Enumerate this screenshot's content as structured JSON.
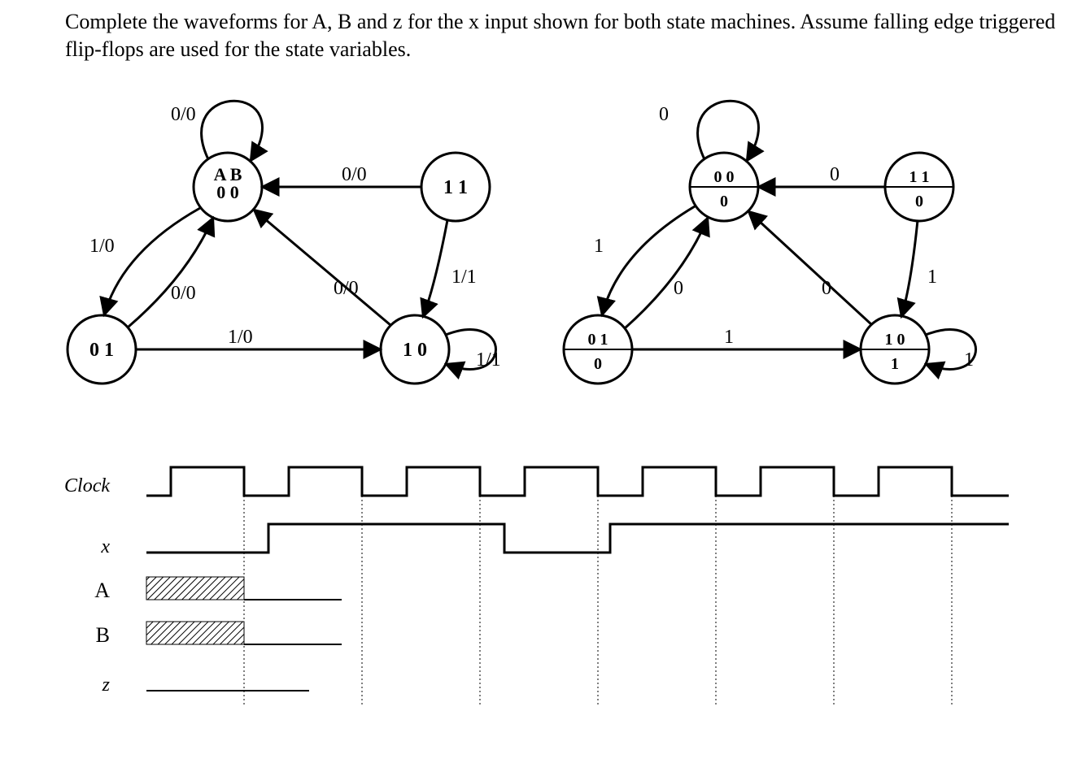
{
  "instructions": "Complete the waveforms for A, B and z for the x input shown for both state machines. Assume falling edge triggered flip-flops are used for the state variables.",
  "mealy": {
    "states": {
      "s00": {
        "label1": "A B",
        "label2": "0 0"
      },
      "s01": {
        "label": "0 1"
      },
      "s11": {
        "label": "1 1"
      },
      "s10": {
        "label": "1 0"
      }
    },
    "edges": {
      "s00_self": "0/0",
      "s00_s01": "1/0",
      "s01_s00": "0/0",
      "s01_s10": "1/0",
      "s10_s00": "0/0",
      "s10_self": "1/1",
      "s11_s00": "0/0",
      "s11_s10": "1/1"
    }
  },
  "moore": {
    "states": {
      "s00": {
        "label": "0 0",
        "out": "0"
      },
      "s01": {
        "label": "0 1",
        "out": "0"
      },
      "s11": {
        "label": "1 1",
        "out": "0"
      },
      "s10": {
        "label": "1 0",
        "out": "1"
      }
    },
    "edges": {
      "s00_self": "0",
      "s00_s01": "1",
      "s01_s00": "0",
      "s01_s10": "1",
      "s10_s00": "0",
      "s10_self": "1",
      "s11_s00": "0",
      "s11_s10": "1"
    }
  },
  "waveform": {
    "labels": {
      "clock": "Clock",
      "x": "x",
      "A": "A",
      "B": "B",
      "z": "z"
    }
  }
}
